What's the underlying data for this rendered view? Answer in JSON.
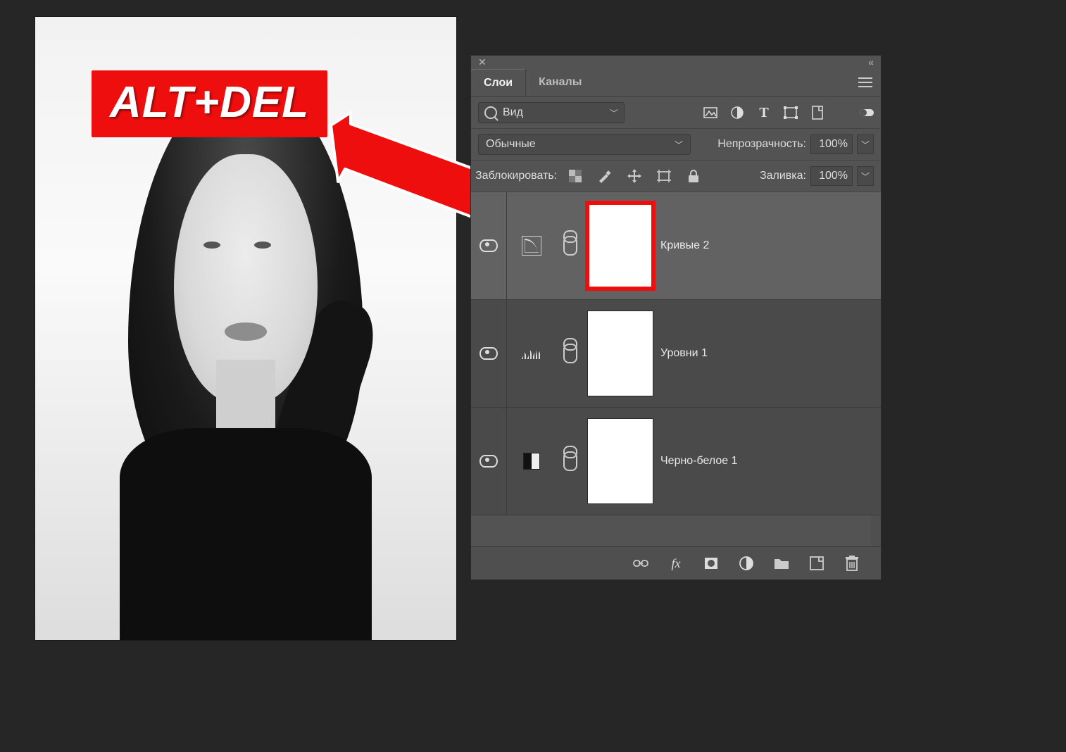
{
  "annotation": {
    "badge_text": "ALT+DEL"
  },
  "colors": {
    "accent": "#ef0e0e",
    "panel_bg": "#535353",
    "row_bg": "#4a4a4a",
    "selected_bg": "#626262"
  },
  "panel": {
    "tabs": [
      {
        "label": "Слои",
        "active": true
      },
      {
        "label": "Каналы",
        "active": false
      }
    ],
    "search_label": "Вид",
    "filter_icons": [
      "image-filter-icon",
      "adjustment-filter-icon",
      "type-filter-icon",
      "shape-filter-icon",
      "smartobject-filter-icon"
    ],
    "blend_mode": "Обычные",
    "opacity_label": "Непрозрачность:",
    "opacity_value": "100%",
    "lock_label": "Заблокировать:",
    "lock_icons": [
      "lock-pixels-icon",
      "lock-brush-icon",
      "lock-move-icon",
      "lock-artboard-icon",
      "lock-all-icon"
    ],
    "fill_label": "Заливка:",
    "fill_value": "100%",
    "layers": [
      {
        "name": "Кривые 2",
        "type": "curves",
        "selected": true,
        "highlight_mask": true
      },
      {
        "name": "Уровни 1",
        "type": "levels",
        "selected": false,
        "highlight_mask": false
      },
      {
        "name": "Черно-белое 1",
        "type": "bw",
        "selected": false,
        "highlight_mask": false
      }
    ],
    "footer_icons": [
      "link-layers-icon",
      "fx-icon",
      "add-mask-icon",
      "new-adjustment-icon",
      "new-group-icon",
      "new-layer-icon",
      "delete-layer-icon"
    ]
  }
}
